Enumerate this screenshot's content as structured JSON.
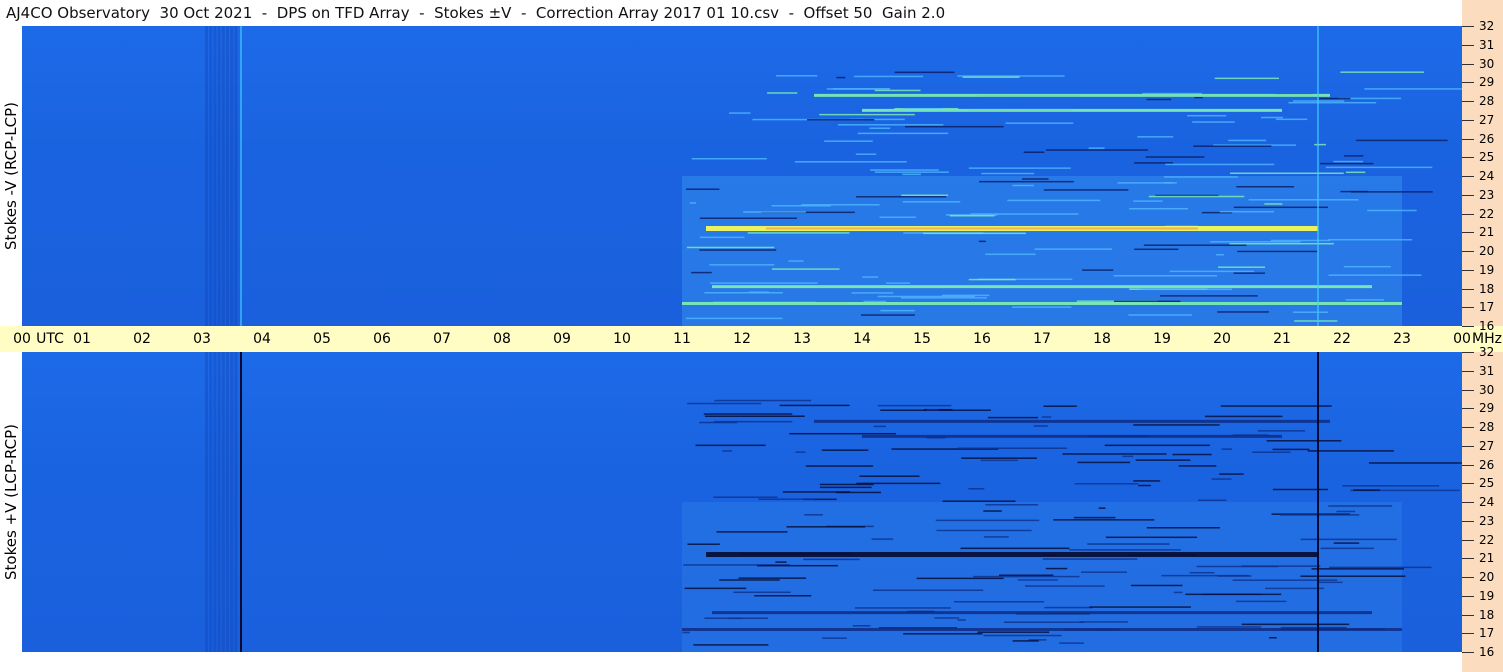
{
  "title": "AJ4CO Observatory  30 Oct 2021  -  DPS on TFD Array  -  Stokes ±V  -  Correction Array 2017 01 10.csv  -  Offset 50  Gain 2.0",
  "chart_data": [
    {
      "type": "heatmap",
      "panel": "top",
      "ylabel": "Stokes -V (RCP-LCP)",
      "x_ticks": [
        "00",
        "01",
        "02",
        "03",
        "04",
        "05",
        "06",
        "07",
        "08",
        "09",
        "10",
        "11",
        "12",
        "13",
        "14",
        "15",
        "16",
        "17",
        "18",
        "19",
        "20",
        "21",
        "22",
        "23",
        "00"
      ],
      "x_units": "UTC",
      "y_ticks": [
        "16",
        "17",
        "18",
        "19",
        "20",
        "21",
        "22",
        "23",
        "24",
        "25",
        "26",
        "27",
        "28",
        "29",
        "30",
        "31",
        "32"
      ],
      "y_units": "MHz",
      "xlim": [
        0,
        24
      ],
      "ylim": [
        16,
        32
      ],
      "markers_utc": [
        3.65,
        21.6
      ],
      "emission_bands": [
        {
          "freq_mhz": 21.2,
          "start_utc": 11.4,
          "end_utc": 21.6,
          "strength": "strong"
        },
        {
          "freq_mhz": 28.3,
          "start_utc": 13.2,
          "end_utc": 21.8,
          "strength": "moderate"
        },
        {
          "freq_mhz": 27.5,
          "start_utc": 14.0,
          "end_utc": 21.0,
          "strength": "moderate"
        },
        {
          "freq_mhz": 17.2,
          "start_utc": 11.0,
          "end_utc": 23.0,
          "strength": "moderate"
        },
        {
          "freq_mhz": 18.1,
          "start_utc": 11.5,
          "end_utc": 22.5,
          "strength": "moderate"
        }
      ],
      "colors": {
        "background": "#1a63e0",
        "weak": "#4fb8ff",
        "moderate": "#7ff0b0",
        "strong": "#ffff50",
        "peak": "#ff4040",
        "dark": "#0a1a60"
      }
    },
    {
      "type": "heatmap",
      "panel": "bottom",
      "ylabel": "Stokes +V (LCP-RCP)",
      "x_ticks": [
        "00",
        "01",
        "02",
        "03",
        "04",
        "05",
        "06",
        "07",
        "08",
        "09",
        "10",
        "11",
        "12",
        "13",
        "14",
        "15",
        "16",
        "17",
        "18",
        "19",
        "20",
        "21",
        "22",
        "23",
        "00"
      ],
      "x_units": "UTC",
      "y_ticks": [
        "16",
        "17",
        "18",
        "19",
        "20",
        "21",
        "22",
        "23",
        "24",
        "25",
        "26",
        "27",
        "28",
        "29",
        "30",
        "31",
        "32"
      ],
      "y_units": "MHz",
      "xlim": [
        0,
        24
      ],
      "ylim": [
        16,
        32
      ],
      "markers_utc": [
        3.65,
        21.6
      ],
      "emission_bands": [
        {
          "freq_mhz": 21.2,
          "start_utc": 11.4,
          "end_utc": 21.6,
          "strength": "strong"
        },
        {
          "freq_mhz": 28.3,
          "start_utc": 13.2,
          "end_utc": 21.8,
          "strength": "moderate"
        },
        {
          "freq_mhz": 27.5,
          "start_utc": 14.0,
          "end_utc": 21.0,
          "strength": "moderate"
        },
        {
          "freq_mhz": 17.2,
          "start_utc": 11.0,
          "end_utc": 23.0,
          "strength": "moderate"
        },
        {
          "freq_mhz": 18.1,
          "start_utc": 11.5,
          "end_utc": 22.5,
          "strength": "moderate"
        }
      ],
      "colors": {
        "background": "#1a63e0",
        "weak": "#3f9cf0",
        "moderate": "#0e2f8a",
        "strong": "#050a30",
        "dark": "#050a30"
      }
    }
  ]
}
